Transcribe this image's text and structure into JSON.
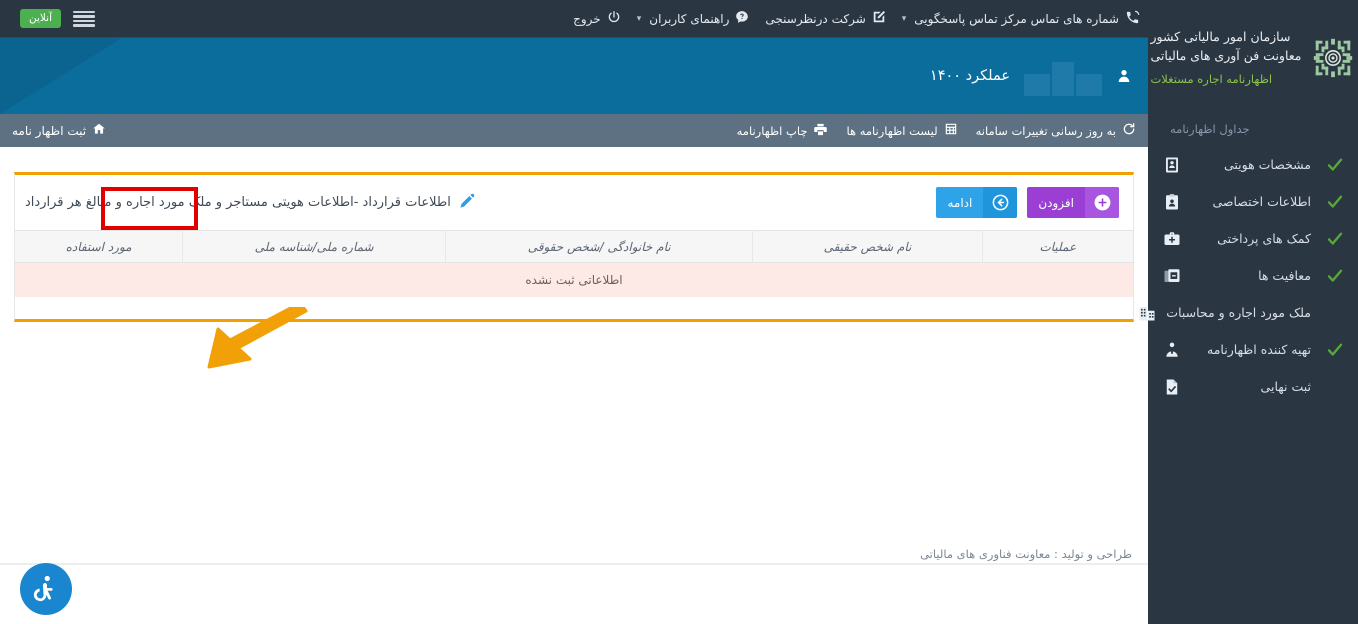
{
  "brand": {
    "line1": "سازمان امور مالیاتی کشور",
    "line2": "معاونت فن آوری های مالیاتی",
    "subtitle": "اظهارنامه اجاره مستغلات",
    "emblem_icon": "tax-organization-emblem-icon",
    "emblem_color": "#9cc9a0"
  },
  "sidebar": {
    "caption": "جداول اظهارنامه",
    "items": [
      {
        "label": "مشخصات هویتی",
        "icon": "id-card-icon",
        "checked": true
      },
      {
        "label": "اطلاعات اختصاصی",
        "icon": "clipboard-user-icon",
        "checked": true
      },
      {
        "label": "کمک های پرداختی",
        "icon": "medical-briefcase-icon",
        "checked": true
      },
      {
        "label": "معافیت ها",
        "icon": "card-minus-icon",
        "checked": true
      },
      {
        "label": "ملک مورد اجاره و محاسبات",
        "icon": "building-icon",
        "checked": false
      },
      {
        "label": "تهیه کننده اظهارنامه",
        "icon": "person-upload-icon",
        "checked": true
      },
      {
        "label": "ثبت نهایی",
        "icon": "document-check-icon",
        "checked": false
      }
    ],
    "check_color": "#57a836"
  },
  "topnav": {
    "menu_icon": "hamburger-menu-icon",
    "status_badge": "آنلاین",
    "status_color": "#4caf50",
    "items": [
      {
        "label": "شماره های تماس مرکز تماس پاسخگویی",
        "icon": "phone-icon",
        "caret": true
      },
      {
        "label": "شرکت درنظرسنجی",
        "icon": "edit-square-icon",
        "caret": false
      },
      {
        "label": "راهنمای کاربران",
        "icon": "help-chat-icon",
        "caret": true
      },
      {
        "label": "خروج",
        "icon": "power-icon",
        "caret": false
      }
    ]
  },
  "banner": {
    "title": "عملکرد ۱۴۰۰",
    "user_icon": "user-icon",
    "bg_color": "#0a6d9c"
  },
  "breadcrumb": {
    "home_icon": "home-icon",
    "label": "ثبت اظهار نامه",
    "tools": [
      {
        "label": "به روز رسانی تغییرات سامانه",
        "icon": "refresh-icon"
      },
      {
        "label": "لیست اظهارنامه ها",
        "icon": "grid-list-icon"
      },
      {
        "label": "چاپ اظهارنامه",
        "icon": "print-icon"
      }
    ]
  },
  "card": {
    "title": "اطلاعات قرارداد -اطلاعات هویتی مستاجر و ملک مورد اجاره و مبالغ هر قرارداد",
    "title_icon": "pen-edit-icon",
    "accent_color": "#f0a000",
    "buttons": {
      "add": {
        "label": "افزودن",
        "icon": "plus-circle-icon",
        "color": "#9b3fd4"
      },
      "continue": {
        "label": "ادامه",
        "icon": "arrow-circle-left-icon",
        "color": "#2ea3e8"
      }
    }
  },
  "table": {
    "columns": [
      "عملیات",
      "نام شخص حقیقی",
      "نام خانوادگی /شخص حقوقی",
      "شماره ملی/شناسه ملی",
      "مورد استفاده"
    ],
    "empty_message": "اطلاعاتی ثبت نشده",
    "empty_row_bg": "#fde9e6"
  },
  "annotation": {
    "highlight_color": "#e00000",
    "arrow_color": "#f2a007",
    "target": "add-button"
  },
  "footer": {
    "text": "طراحی و تولید : معاونت فناوری های مالیاتی",
    "a11y_icon": "accessibility-wheelchair-icon",
    "a11y_color": "#1b86d0"
  }
}
